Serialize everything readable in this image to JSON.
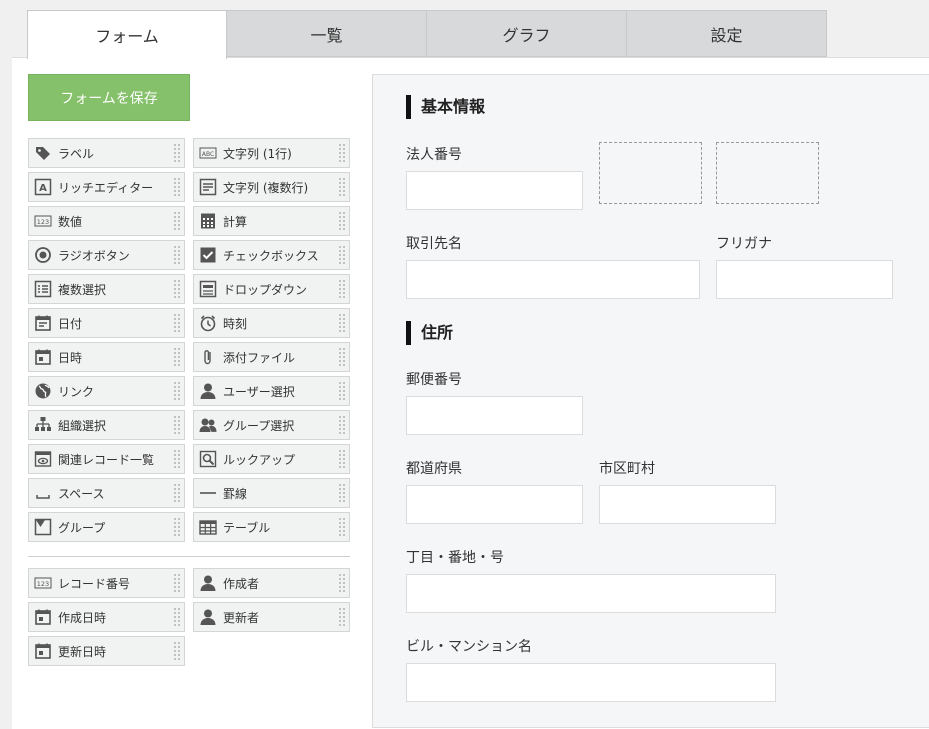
{
  "tabs": [
    {
      "label": "フォーム",
      "active": true
    },
    {
      "label": "一覧",
      "active": false
    },
    {
      "label": "グラフ",
      "active": false
    },
    {
      "label": "設定",
      "active": false
    }
  ],
  "save_button": "フォームを保存",
  "palette": [
    {
      "label": "ラベル",
      "icon": "tag-icon"
    },
    {
      "label": "文字列 (1行)",
      "icon": "abc-text-icon"
    },
    {
      "label": "リッチエディター",
      "icon": "rich-editor-icon"
    },
    {
      "label": "文字列 (複数行)",
      "icon": "multiline-text-icon"
    },
    {
      "label": "数値",
      "icon": "number-icon"
    },
    {
      "label": "計算",
      "icon": "calculator-icon"
    },
    {
      "label": "ラジオボタン",
      "icon": "radio-icon"
    },
    {
      "label": "チェックボックス",
      "icon": "checkbox-icon"
    },
    {
      "label": "複数選択",
      "icon": "multi-select-icon"
    },
    {
      "label": "ドロップダウン",
      "icon": "dropdown-icon"
    },
    {
      "label": "日付",
      "icon": "date-icon"
    },
    {
      "label": "時刻",
      "icon": "clock-icon"
    },
    {
      "label": "日時",
      "icon": "datetime-icon"
    },
    {
      "label": "添付ファイル",
      "icon": "paperclip-icon"
    },
    {
      "label": "リンク",
      "icon": "globe-icon"
    },
    {
      "label": "ユーザー選択",
      "icon": "user-icon"
    },
    {
      "label": "組織選択",
      "icon": "org-icon"
    },
    {
      "label": "グループ選択",
      "icon": "group-icon"
    },
    {
      "label": "関連レコード一覧",
      "icon": "related-records-icon"
    },
    {
      "label": "ルックアップ",
      "icon": "lookup-icon"
    },
    {
      "label": "スペース",
      "icon": "space-icon"
    },
    {
      "label": "罫線",
      "icon": "line-icon"
    },
    {
      "label": "グループ",
      "icon": "group-field-icon"
    },
    {
      "label": "テーブル",
      "icon": "table-icon"
    }
  ],
  "system_fields": [
    {
      "label": "レコード番号",
      "icon": "number-icon"
    },
    {
      "label": "作成者",
      "icon": "user-icon"
    },
    {
      "label": "作成日時",
      "icon": "datetime-icon"
    },
    {
      "label": "更新者",
      "icon": "user-icon"
    },
    {
      "label": "更新日時",
      "icon": "datetime-icon"
    }
  ],
  "form": {
    "section1": "基本情報",
    "corporate_number": "法人番号",
    "client_name": "取引先名",
    "furigana": "フリガナ",
    "section2": "住所",
    "postal_code": "郵便番号",
    "prefecture": "都道府県",
    "city": "市区町村",
    "street": "丁目・番地・号",
    "building": "ビル・マンション名"
  },
  "colors": {
    "save_button": "#85c06a",
    "tab_active": "#ffffff",
    "tab_inactive": "#d7d9da"
  }
}
